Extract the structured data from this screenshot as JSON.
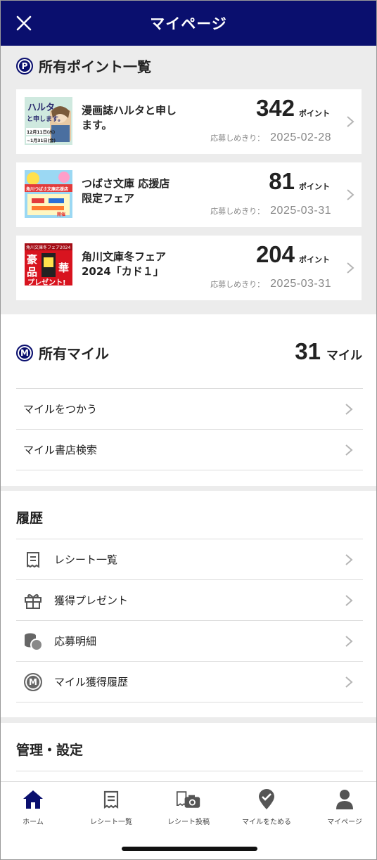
{
  "header": {
    "title": "マイページ",
    "close_icon": "close-icon"
  },
  "points": {
    "badge": "P",
    "title": "所有ポイント一覧",
    "cards": [
      {
        "name": "漫画誌ハルタと申します。",
        "points": "342",
        "unit": "ポイント",
        "deadline_label": "応募しめきり：",
        "deadline": "2025-02-28",
        "thumb": {
          "top": "ハルタ",
          "middle": "と申します。",
          "bottom1": "12月11日(水)",
          "bottom2": "~1月31日(金)"
        }
      },
      {
        "name": "つばさ文庫 応援店限定フェア",
        "points": "81",
        "unit": "ポイント",
        "deadline_label": "応募しめきり：",
        "deadline": "2025-03-31",
        "thumb": {
          "top": "角川つばさ文庫応援店",
          "bottom": "開催"
        }
      },
      {
        "name": "角川文庫冬フェア2024「カド１」",
        "points": "204",
        "unit": "ポイント",
        "deadline_label": "応募しめきり：",
        "deadline": "2025-03-31",
        "thumb": {
          "top": "角川文庫冬フェア2024",
          "left1": "豪",
          "left2": "品",
          "right1": "華",
          "bottom": "プレゼント!"
        }
      }
    ]
  },
  "miles": {
    "badge": "M",
    "title": "所有マイル",
    "value": "31",
    "unit": "マイル",
    "rows": [
      {
        "label": "マイルをつかう"
      },
      {
        "label": "マイル書店検索"
      }
    ]
  },
  "history": {
    "title": "履歴",
    "rows": [
      {
        "label": "レシート一覧",
        "icon": "receipt-icon"
      },
      {
        "label": "獲得プレゼント",
        "icon": "gift-icon"
      },
      {
        "label": "応募明細",
        "icon": "coins-icon"
      },
      {
        "label": "マイル獲得履歴",
        "icon": "mile-badge-icon",
        "icon_letter": "M"
      }
    ]
  },
  "settings": {
    "title": "管理・設定"
  },
  "tabbar": {
    "tabs": [
      {
        "label": "ホーム",
        "icon": "home-icon",
        "active": true
      },
      {
        "label": "レシート一覧",
        "icon": "receipt-icon"
      },
      {
        "label": "レシート投稿",
        "icon": "camera-receipt-icon"
      },
      {
        "label": "マイルをためる",
        "icon": "location-check-icon"
      },
      {
        "label": "マイページ",
        "icon": "user-icon"
      }
    ]
  },
  "colors": {
    "brand": "#0a0f6e",
    "background": "#ececec",
    "text": "#222222",
    "muted": "#888888"
  }
}
